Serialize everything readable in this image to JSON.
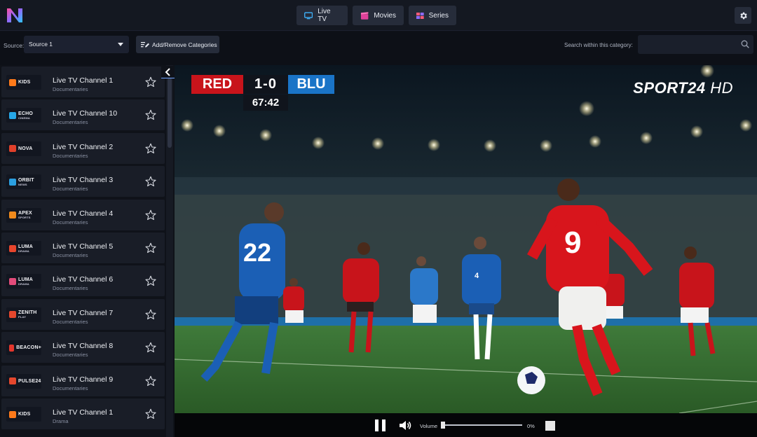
{
  "app": {
    "logo": "N"
  },
  "nav": {
    "live_tv": "Live TV",
    "movies": "Movies",
    "series": "Series"
  },
  "toolbar": {
    "source_label": "Source:",
    "source_value": "Source 1",
    "categories_button": "Add/Remove Categories",
    "search_label": "Search within this category:",
    "search_value": ""
  },
  "channels": [
    {
      "name": "Live TV Channel 1",
      "category": "Documentaries",
      "logo_text": "KIDS",
      "logo_sub": "",
      "logo_color": "#ff7a1a"
    },
    {
      "name": "Live TV Channel 10",
      "category": "Documentaries",
      "logo_text": "ECHO",
      "logo_sub": "CINEMA",
      "logo_color": "#27a8e8"
    },
    {
      "name": "Live TV Channel 2",
      "category": "Documentaries",
      "logo_text": "NOVA",
      "logo_sub": "",
      "logo_color": "#e0402a"
    },
    {
      "name": "Live TV Channel 3",
      "category": "Documentaries",
      "logo_text": "ORBIT",
      "logo_sub": "NEWS",
      "logo_color": "#2b9fe0"
    },
    {
      "name": "Live TV Channel 4",
      "category": "Documentaries",
      "logo_text": "APEX",
      "logo_sub": "SPORTS",
      "logo_color": "#f08a1c"
    },
    {
      "name": "Live TV Channel 5",
      "category": "Documentaries",
      "logo_text": "LUMA",
      "logo_sub": "DRAMA",
      "logo_color": "#e8452c"
    },
    {
      "name": "Live TV Channel 6",
      "category": "Documentaries",
      "logo_text": "LUMA",
      "logo_sub": "DRAMA",
      "logo_color": "#e24b7a"
    },
    {
      "name": "Live TV Channel 7",
      "category": "Documentaries",
      "logo_text": "ZENITH",
      "logo_sub": "PLAY",
      "logo_color": "#e5472d"
    },
    {
      "name": "Live TV Channel 8",
      "category": "Documentaries",
      "logo_text": "BEACON+",
      "logo_sub": "",
      "logo_color": "#e5362c"
    },
    {
      "name": "Live TV Channel 9",
      "category": "Documentaries",
      "logo_text": "PULSE24",
      "logo_sub": "",
      "logo_color": "#e5472d"
    },
    {
      "name": "Live TV Channel 1",
      "category": "Drama",
      "logo_text": "KIDS",
      "logo_sub": "",
      "logo_color": "#ff7a1a"
    }
  ],
  "player": {
    "home_team": "RED",
    "score": "1-0",
    "away_team": "BLU",
    "clock": "67:42",
    "broadcaster": "SPORT24",
    "broadcaster_suffix": "HD",
    "home_number": "9",
    "away_number": "22",
    "away_number_2": "4"
  },
  "controls": {
    "volume_label": "Volume",
    "volume_percent": "0%",
    "volume_level": 0
  },
  "colors": {
    "accent": "#4a8cff",
    "home_team": "#c8141b",
    "away_team": "#1a74c7"
  }
}
